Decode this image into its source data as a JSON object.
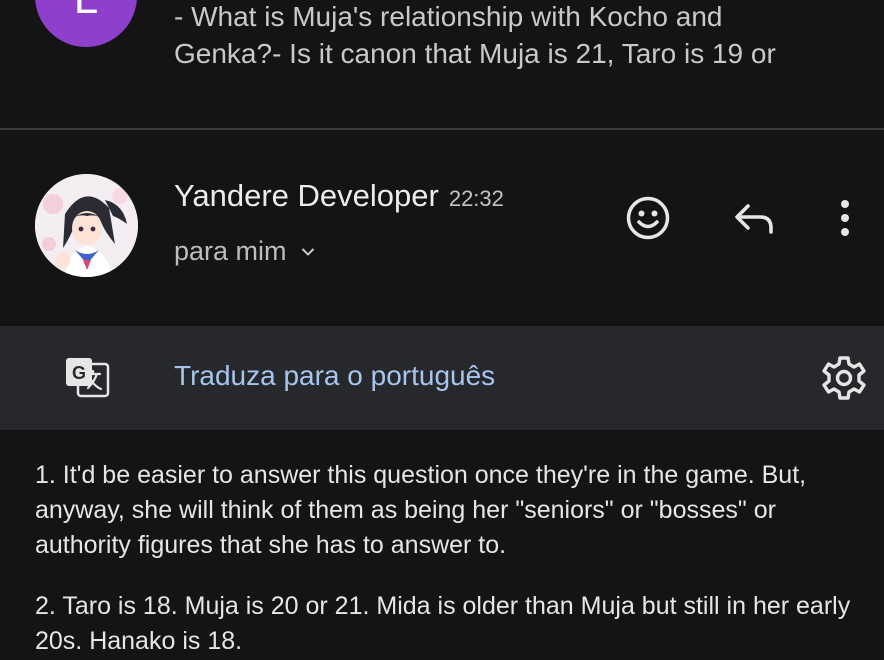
{
  "previous_message": {
    "avatar_initial": "L",
    "snippet_line1": "- What is Muja's relationship with Kocho and",
    "snippet_line2": "Genka?- Is it canon that Muja is 21, Taro is 19 or"
  },
  "header": {
    "sender_name": "Yandere Developer",
    "time": "22:32",
    "recipient": "para mim"
  },
  "actions": {
    "emoji_icon": "smiley-face-icon",
    "reply_icon": "reply-arrow-icon",
    "more_icon": "vertical-ellipsis-icon"
  },
  "translate": {
    "icon": "google-translate-icon",
    "link_text": "Traduza para o português",
    "settings_icon": "gear-icon"
  },
  "body": {
    "paragraph1": "1. It'd be easier to answer this question once they're in the game. But, anyway, she will think of them as being her \"seniors\" or \"bosses\" or authority figures that she has to answer to.",
    "paragraph2": "2. Taro is 18. Muja is 20 or 21. Mida is older than Muja but still in her early 20s. Hanako is 18."
  },
  "colors": {
    "background": "#141414",
    "translate_bar": "#26282b",
    "link": "#a6c5ee",
    "avatar_purple": "#8e3fcb"
  }
}
